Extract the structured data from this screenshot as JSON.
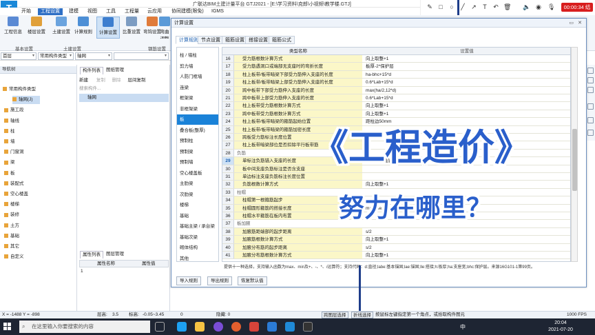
{
  "window": {
    "title": "广联达BIM土建计量平台 GTJ2021 - [E:\\学习资料\\克郎\\小视频\\教学楼.GTJ]"
  },
  "menu": {
    "items": [
      "开始",
      "工程设置",
      "建模",
      "视图",
      "工具",
      "工程量",
      "云应用",
      "协同建模(限免)",
      "IGMS"
    ],
    "active_index": 1
  },
  "ribbon": {
    "buttons": [
      "工程信息",
      "楼层设置",
      "土建设置",
      "计算规则",
      "计算设置",
      "比重设置",
      "弯钩设置",
      "弯曲调整值"
    ],
    "selected_index": 4,
    "groups": [
      "基本设置",
      "土建设置",
      "钢筋设置"
    ]
  },
  "recorder": {
    "time": "00:00:34",
    "rec_label": "结束"
  },
  "filters": {
    "floor": "首层",
    "type": "常用构件类型",
    "axis": "轴网",
    "blank": ""
  },
  "nav": {
    "header": "导航树",
    "items": [
      "常用构件类型",
      "轴网(J)",
      "施工段",
      "轴线",
      "柱",
      "墙",
      "门窗洞",
      "梁",
      "板",
      "装配式",
      "空心楼盖",
      "楼梯",
      "装修",
      "土方",
      "基础",
      "其它",
      "自定义"
    ]
  },
  "component_list": {
    "tabs": [
      "构件列表",
      "图纸管理"
    ],
    "toolbar": [
      "新建",
      "复制",
      "删除",
      "层间复制"
    ],
    "search_placeholder": "搜索构件...",
    "item": "轴网"
  },
  "properties": {
    "tabs": [
      "属性列表",
      "图层管理"
    ],
    "col_name": "属性名称",
    "col_value": "属性值",
    "row_no": "1"
  },
  "dialog": {
    "title": "计算设置",
    "tabs": [
      "计算规则",
      "节点设置",
      "箍筋设置",
      "搭接设置",
      "箍筋公式"
    ],
    "categories": [
      "柱 / 墙柱",
      "剪力墙",
      "人防门框墙",
      "连梁",
      "框架梁",
      "非框架梁",
      "板",
      "叠合板(整厚)",
      "预制柱",
      "预制梁",
      "预制墙",
      "空心楼盖板",
      "主肋梁",
      "次肋梁",
      "楼梯",
      "基础",
      "基础主梁 / 承台梁",
      "基础次梁",
      "砌体结构",
      "其他"
    ],
    "selected_category": 6,
    "columns": [
      "类型名称",
      "设置值"
    ],
    "rows": [
      {
        "no": "16",
        "name": "受力筋根数计算方式",
        "value": "向上取整+1"
      },
      {
        "no": "17",
        "name": "受力筋遇洞口或端部无支座时的弯折长度",
        "value": "板厚-2*保护层"
      },
      {
        "no": "18",
        "name": "柱上板带/板带暗梁下部受力筋伸入支座的长度",
        "value": "ha-bhc+15*d"
      },
      {
        "no": "19",
        "name": "柱上板带/板带暗梁上部受力筋伸入支座的长度",
        "value": "0.6*Lab+15*d"
      },
      {
        "no": "20",
        "name": "跨中板带下部受力筋伸入支座的长度",
        "value": "max(ha/2,12*d)"
      },
      {
        "no": "21",
        "name": "跨中板带上部受力筋伸入支座的长度",
        "value": "0.6*Lab+15*d"
      },
      {
        "no": "22",
        "name": "柱上板带受力筋根数计算方式",
        "value": "向上取整+1"
      },
      {
        "no": "23",
        "name": "跨中板带受力筋根数计算方式",
        "value": "向上取整+1"
      },
      {
        "no": "24",
        "name": "柱上板带/板带暗梁的箍筋起始位置",
        "value": "距柱边50mm"
      },
      {
        "no": "25",
        "name": "柱上板带/板带暗梁的箍筋加密长度",
        "value": ""
      },
      {
        "no": "26",
        "name": "跨板受力筋标注长度位置",
        "value": ""
      },
      {
        "no": "27",
        "name": "柱上板带暗梁部位是否扣除平行板带筋",
        "value": ""
      },
      {
        "no": "28",
        "name": "负筋",
        "value": "",
        "group": true
      },
      {
        "no": "29",
        "name": "单标注负筋锚入支座的长度",
        "value": "能直锚就直锚",
        "selected": true
      },
      {
        "no": "30",
        "name": "板中间支座负筋标注是否含支座",
        "value": ""
      },
      {
        "no": "31",
        "name": "单边标注支座负筋标注长度位置",
        "value": ""
      },
      {
        "no": "32",
        "name": "负筋根数计算方式",
        "value": "向上取整+1"
      },
      {
        "no": "33",
        "name": "柱帽",
        "value": "",
        "group": true
      },
      {
        "no": "34",
        "name": "柱帽第一根箍筋起步",
        "value": "50"
      },
      {
        "no": "35",
        "name": "柱帽圆形箍筋的搭接长度",
        "value": "max(lae,300)"
      },
      {
        "no": "36",
        "name": "柱帽水平箍筋在板内布置",
        "value": "否"
      },
      {
        "no": "37",
        "name": "板加腋",
        "value": "",
        "group": true
      },
      {
        "no": "38",
        "name": "加腋筋距端部的起步距离",
        "value": "s/2"
      },
      {
        "no": "39",
        "name": "加腋筋根数计算方式",
        "value": "向上取整+1"
      },
      {
        "no": "40",
        "name": "加腋分布筋的起步距离",
        "value": "s/2"
      },
      {
        "no": "41",
        "name": "加腋分布筋根数计算方式",
        "value": "向上取整+1"
      }
    ],
    "hint": "提供十一种选择，支持输入函数为max、min及+、-、*、/运算符；支持代码：d:直径;labe:基本锚固;lae:锚固;lle:搭接;h:板厚;ha:支座宽;bhc:保护层。来源16G101-1第99页。",
    "buttons": [
      "导入规则",
      "导出规则",
      "恢复默认值"
    ]
  },
  "overlay": {
    "line1": "《工程造价》",
    "line2": "努力在哪里？"
  },
  "status": {
    "coords": "X = -1488 Y = -898",
    "floor_height_label": "层高:",
    "floor_height": "3.5",
    "elevation_label": "标高:",
    "elevation": "-0.05~3.45",
    "count": "0",
    "hidden": "隐藏: 0",
    "btn1": "跨图层选择",
    "btn2": "折线选择",
    "hint": "按鼠标左键指定第一个角点，或拾取构件图元",
    "fps": "1000 FPS"
  },
  "taskbar": {
    "search_placeholder": "在这里输入你要搜索的内容",
    "time": "20:04",
    "date": "2021-07-20",
    "ime": "中"
  }
}
